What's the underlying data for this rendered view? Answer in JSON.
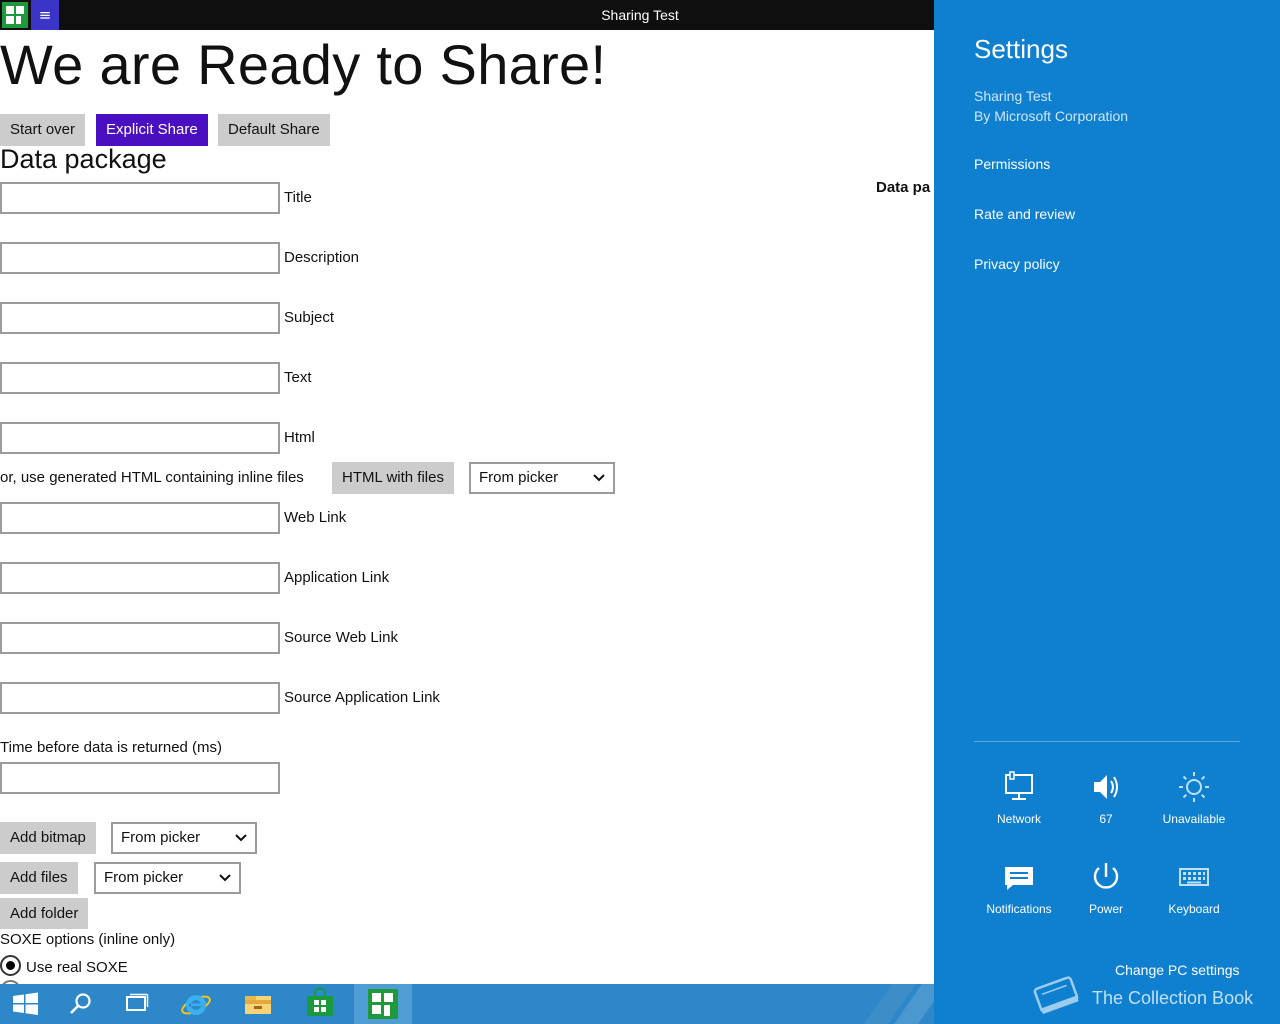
{
  "window": {
    "title": "Sharing Test",
    "menu_glyph": "≡"
  },
  "main": {
    "heading": "We are Ready to Share!",
    "buttons": {
      "start_over": "Start over",
      "explicit_share": "Explicit Share",
      "default_share": "Default Share"
    },
    "section_title": "Data package",
    "cut_off_label": "Data pa",
    "fields": [
      {
        "label": "Title",
        "value": ""
      },
      {
        "label": "Description",
        "value": ""
      },
      {
        "label": "Subject",
        "value": ""
      },
      {
        "label": "Text",
        "value": ""
      },
      {
        "label": "Html",
        "value": ""
      }
    ],
    "inline_files_text": "or, use generated HTML containing inline files",
    "html_with_files_button": "HTML with files",
    "html_files_source": "From picker",
    "link_fields": [
      {
        "label": "Web Link",
        "value": ""
      },
      {
        "label": "Application Link",
        "value": ""
      },
      {
        "label": "Source Web Link",
        "value": ""
      },
      {
        "label": "Source Application Link",
        "value": ""
      }
    ],
    "delay_label": "Time before data is returned (ms)",
    "delay_value": "",
    "add_bitmap_button": "Add bitmap",
    "bitmap_source": "From picker",
    "add_files_button": "Add files",
    "files_source": "From picker",
    "add_folder_button": "Add folder",
    "soxe_options_label": "SOXE options (inline only)",
    "soxe_radio_real": "Use real SOXE"
  },
  "taskbar": {
    "items": [
      "start-button",
      "search-button",
      "task-view-button",
      "internet-explorer",
      "file-explorer",
      "store",
      "sharing-test-app"
    ],
    "active": "sharing-test-app"
  },
  "settings": {
    "title": "Settings",
    "app_name": "Sharing Test",
    "publisher": "By Microsoft Corporation",
    "links": [
      "Permissions",
      "Rate and review",
      "Privacy policy"
    ],
    "tiles": {
      "network": "Network",
      "volume": "67",
      "brightness": "Unavailable",
      "notifications": "Notifications",
      "power": "Power",
      "keyboard": "Keyboard"
    },
    "change_pc_settings": "Change PC settings"
  },
  "watermark": "The Collection Book",
  "colors": {
    "titlebar": "#0f0f0f",
    "accent_purple": "#4a0fc0",
    "charm_blue": "#0f7fd0",
    "taskbar_blue": "#2d87c8",
    "app_green": "#1e9a3c"
  }
}
